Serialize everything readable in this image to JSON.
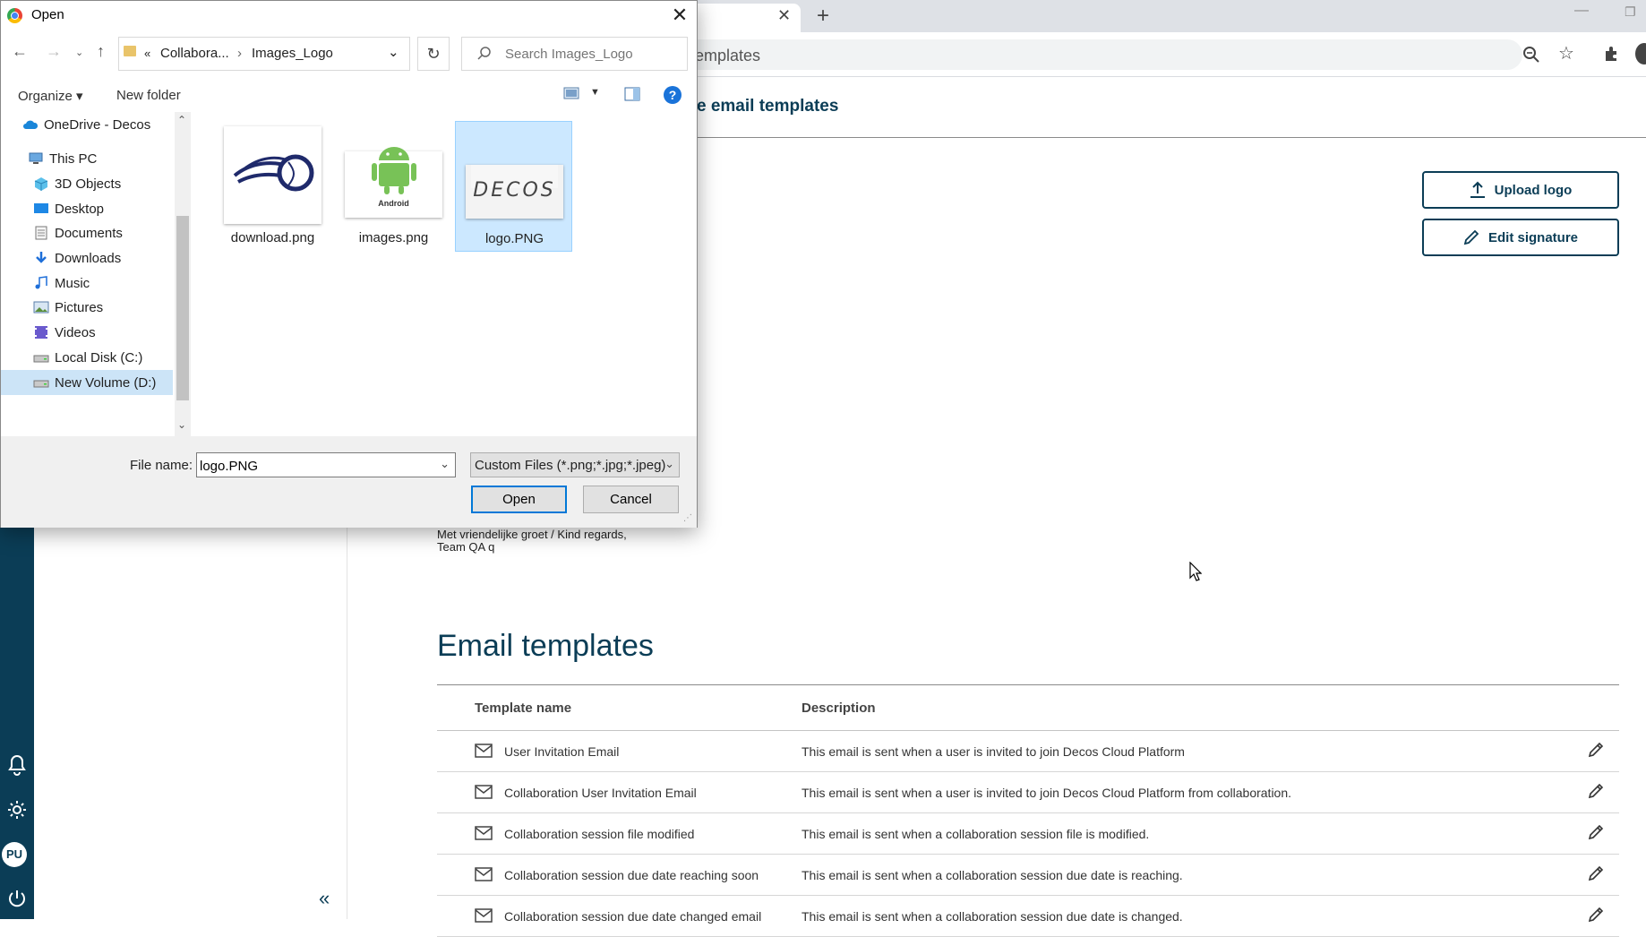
{
  "browser": {
    "address_partial": "emplates",
    "page_title_partial": "e email templates"
  },
  "app": {
    "avatar_initials": "PU",
    "collapse_glyph": "«",
    "upload_logo_label": "Upload logo",
    "edit_signature_label": "Edit signature",
    "signature_line1": "Met vriendelijke groet / Kind regards,",
    "signature_line2": "Team QA  q",
    "section_title": "Email templates",
    "table": {
      "col_name": "Template name",
      "col_description": "Description",
      "rows": [
        {
          "name": "User Invitation Email",
          "description": "This email is sent when a user is invited to join Decos Cloud Platform"
        },
        {
          "name": "Collaboration User Invitation Email",
          "description": "This email is sent when a user is invited to join Decos Cloud Platform from collaboration."
        },
        {
          "name": "Collaboration session file modified",
          "description": "This email is sent when a collaboration session file is modified."
        },
        {
          "name": "Collaboration session due date reaching soon",
          "description": "This email is sent when a collaboration session due date is reaching."
        },
        {
          "name": "Collaboration session due date changed email",
          "description": "This email is sent when a collaboration session due date is changed."
        }
      ]
    }
  },
  "dialog": {
    "title": "Open",
    "breadcrumb_prefix": "«",
    "breadcrumb_parent": "Collabora...",
    "breadcrumb_sep": "›",
    "breadcrumb_current": "Images_Logo",
    "search_placeholder": "Search Images_Logo",
    "organize_label": "Organize ▾",
    "new_folder_label": "New folder",
    "help_glyph": "?",
    "nav_items": [
      {
        "label": "OneDrive - Decos",
        "icon": "cloud-icon"
      },
      {
        "label": "This PC",
        "icon": "computer-icon"
      },
      {
        "label": "3D Objects",
        "icon": "cube-icon"
      },
      {
        "label": "Desktop",
        "icon": "desktop-icon"
      },
      {
        "label": "Documents",
        "icon": "document-icon"
      },
      {
        "label": "Downloads",
        "icon": "download-icon"
      },
      {
        "label": "Music",
        "icon": "music-icon"
      },
      {
        "label": "Pictures",
        "icon": "pictures-icon"
      },
      {
        "label": "Videos",
        "icon": "video-icon"
      },
      {
        "label": "Local Disk (C:)",
        "icon": "drive-icon"
      },
      {
        "label": "New Volume (D:)",
        "icon": "drive-icon",
        "selected": true
      }
    ],
    "files": [
      {
        "label": "download.png",
        "thumb": "baseball-logo"
      },
      {
        "label": "images.png",
        "thumb": "android-logo",
        "thumb_text": "Android"
      },
      {
        "label": "logo.PNG",
        "thumb": "decos-logo",
        "thumb_text": "DECOS",
        "selected": true
      }
    ],
    "file_name_label": "File name:",
    "file_name_value": "logo.PNG",
    "file_type": "Custom Files (*.png;*.jpg;*.jpeg)",
    "open_label": "Open",
    "cancel_label": "Cancel"
  },
  "colors": {
    "app_primary": "#0b3d56",
    "selection": "#cce8ff",
    "help_blue": "#1a73d9"
  }
}
